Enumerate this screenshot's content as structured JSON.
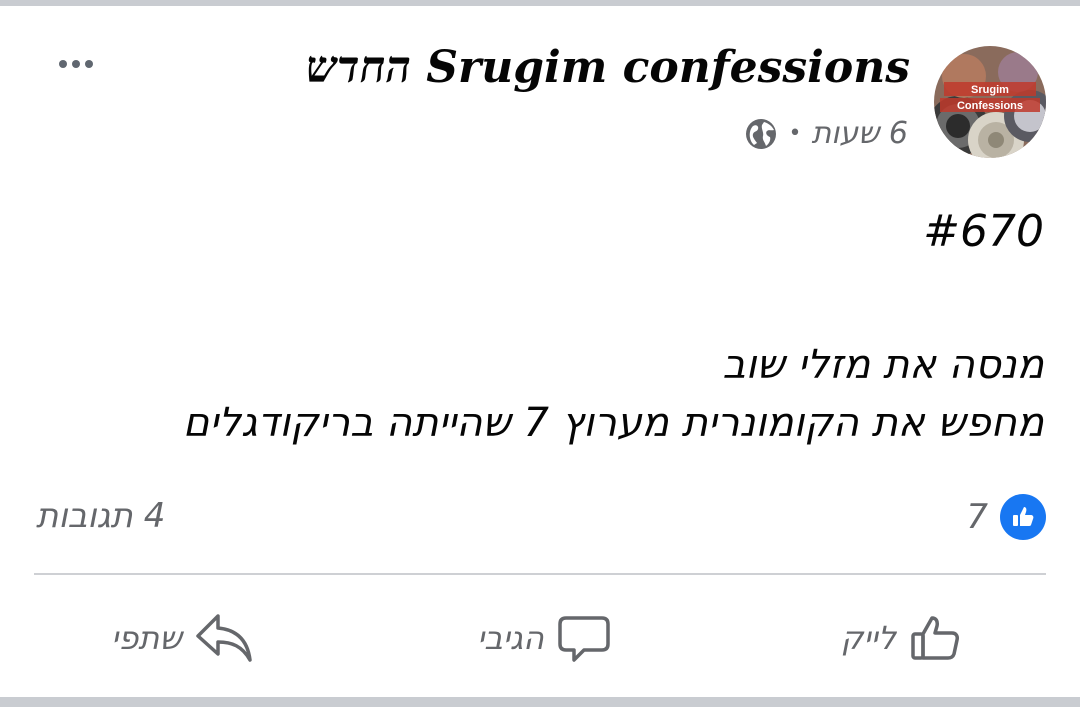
{
  "post": {
    "author": "Srugim confessions החדש",
    "time": "6 שעות",
    "separator": "•",
    "post_id": "#670",
    "text_lines": [
      "מנסה את מזלי שוב",
      "מחפש את הקומונרית מערוץ 7 שהייתה בריקודגלים"
    ]
  },
  "stats": {
    "reaction_count": "7",
    "comments": "4 תגובות"
  },
  "actions": {
    "like": "לייק",
    "comment": "הגיבי",
    "share": "שתפי"
  },
  "icons": {
    "more": "more-icon",
    "privacy": "globe-icon",
    "reaction": "like-reaction-icon",
    "like": "thumbs-up-icon",
    "comment": "comment-bubble-icon",
    "share": "share-arrow-icon"
  },
  "colors": {
    "facebook_blue": "#1877f2",
    "secondary_text": "#65676b",
    "primary_text": "#050505",
    "divider": "#ced0d4"
  }
}
